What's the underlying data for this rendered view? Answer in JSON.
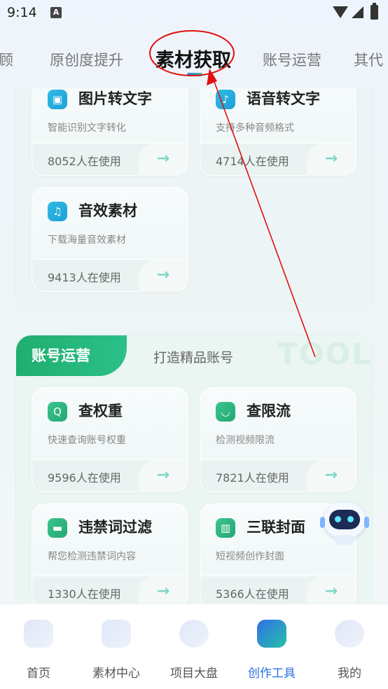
{
  "status_bar": {
    "time": "9:14",
    "notification_icon": "A"
  },
  "top_tabs": {
    "items": [
      "顾",
      "原创度提升",
      "素材获取",
      "账号运营",
      "其代"
    ],
    "active": "素材获取"
  },
  "material_section": {
    "cards": [
      {
        "title": "图片转文字",
        "subtitle": "智能识别文字转化",
        "users": "8052人在使用",
        "icon": "image-icon",
        "arrow": "→"
      },
      {
        "title": "语音转文字",
        "subtitle": "支持多种音频格式",
        "users": "4714人在使用",
        "icon": "voice-icon",
        "arrow": "→"
      },
      {
        "title": "音效素材",
        "subtitle": "下载海量音效素材",
        "users": "9413人在使用",
        "icon": "music-note-icon",
        "icon_glyph": "♫",
        "arrow": "→"
      }
    ]
  },
  "account_section": {
    "title": "账号运营",
    "subtitle": "打造精品账号",
    "watermark": "TOOL",
    "cards": [
      {
        "title": "查权重",
        "subtitle": "快速查询账号权重",
        "users": "9596人在使用",
        "icon": "search-weight-icon",
        "icon_glyph": "Q",
        "arrow": "→"
      },
      {
        "title": "查限流",
        "subtitle": "检测视频限流",
        "users": "7821人在使用",
        "icon": "shield-icon",
        "icon_glyph": "◡",
        "arrow": "→"
      },
      {
        "title": "违禁词过滤",
        "subtitle": "帮您检测违禁词内容",
        "users": "1330人在使用",
        "icon": "filter-icon",
        "icon_glyph": "▬",
        "arrow": "→"
      },
      {
        "title": "三联封面",
        "subtitle": "短视频创作封面",
        "users": "5366人在使用",
        "icon": "cover-icon",
        "icon_glyph": "▥",
        "arrow": "→"
      }
    ]
  },
  "bottom_nav": {
    "items": [
      {
        "label": "首页",
        "icon": "home-icon"
      },
      {
        "label": "素材中心",
        "icon": "folder-icon"
      },
      {
        "label": "项目大盘",
        "icon": "chart-icon"
      },
      {
        "label": "创作工具",
        "icon": "toolbox-icon"
      },
      {
        "label": "我的",
        "icon": "profile-icon"
      }
    ],
    "active": "创作工具"
  },
  "colors": {
    "accent_green": "#1fae6e",
    "accent_blue": "#2a6fe0",
    "annotation_red": "#e01010"
  }
}
